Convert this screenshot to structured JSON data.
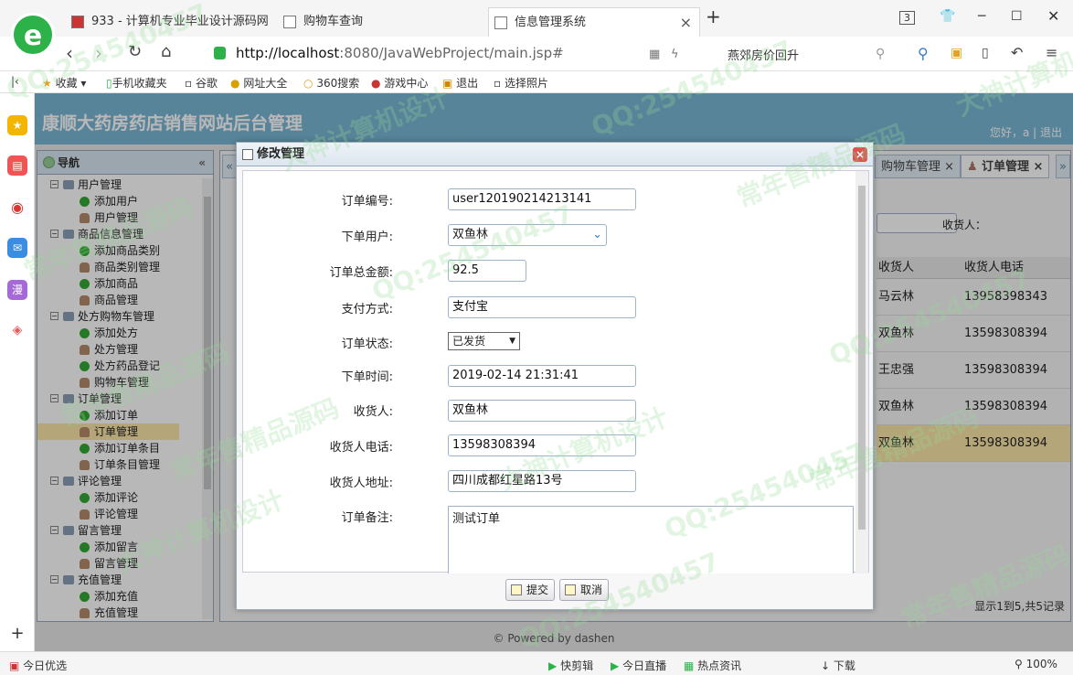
{
  "browser": {
    "logo_letter": "e",
    "tabs": [
      {
        "title": "933 - 计算机专业毕业设计源码网"
      },
      {
        "title": "购物车查询"
      },
      {
        "title": "信息管理系统",
        "close": "×"
      }
    ],
    "new_tab": "+",
    "tab_count": "3",
    "url_host": "http://localhost",
    "url_rest": ":8080/JavaWebProject/main.jsp#",
    "news": "燕郊房价回升",
    "bookmarks": [
      "收藏",
      "手机收藏夹",
      "谷歌",
      "网址大全",
      "360搜索",
      "游戏中心",
      "退出",
      "选择照片"
    ],
    "status_left": "今日优选",
    "status_items": [
      "快剪辑",
      "今日直播",
      "热点资讯",
      "下载"
    ],
    "zoom": "100%"
  },
  "header": {
    "title": "康顺大药房药店销售网站后台管理",
    "user_links": "您好，a | 退出"
  },
  "nav": {
    "title": "导航",
    "collapse": "«",
    "groups": [
      {
        "label": "用户管理",
        "items": [
          {
            "label": "添加用户",
            "kind": "add"
          },
          {
            "label": "用户管理",
            "kind": "user"
          }
        ]
      },
      {
        "label": "商品信息管理",
        "items": [
          {
            "label": "添加商品类别",
            "kind": "add"
          },
          {
            "label": "商品类别管理",
            "kind": "user"
          },
          {
            "label": "添加商品",
            "kind": "add"
          },
          {
            "label": "商品管理",
            "kind": "user"
          }
        ]
      },
      {
        "label": "处方购物车管理",
        "items": [
          {
            "label": "添加处方",
            "kind": "add"
          },
          {
            "label": "处方管理",
            "kind": "user"
          },
          {
            "label": "处方药品登记",
            "kind": "add"
          },
          {
            "label": "购物车管理",
            "kind": "user"
          }
        ]
      },
      {
        "label": "订单管理",
        "items": [
          {
            "label": "添加订单",
            "kind": "add"
          },
          {
            "label": "订单管理",
            "kind": "user",
            "selected": true
          },
          {
            "label": "添加订单条目",
            "kind": "add"
          },
          {
            "label": "订单条目管理",
            "kind": "user"
          }
        ]
      },
      {
        "label": "评论管理",
        "items": [
          {
            "label": "添加评论",
            "kind": "add"
          },
          {
            "label": "评论管理",
            "kind": "user"
          }
        ]
      },
      {
        "label": "留言管理",
        "items": [
          {
            "label": "添加留言",
            "kind": "add"
          },
          {
            "label": "留言管理",
            "kind": "user"
          }
        ]
      },
      {
        "label": "充值管理",
        "items": [
          {
            "label": "添加充值",
            "kind": "add"
          },
          {
            "label": "充值管理",
            "kind": "user"
          }
        ]
      }
    ]
  },
  "main": {
    "tabs": [
      {
        "label": "购物车管理 ×"
      },
      {
        "label": "订单管理 ×"
      }
    ],
    "filter_label": "收货人：",
    "columns": [
      "收货人",
      "收货人电话"
    ],
    "rows": [
      {
        "name": "马云林",
        "phone": "13958398343"
      },
      {
        "name": "双鱼林",
        "phone": "13598308394"
      },
      {
        "name": "王忠强",
        "phone": "13598308394"
      },
      {
        "name": "双鱼林",
        "phone": "13598308394"
      },
      {
        "name": "双鱼林",
        "phone": "13598308394",
        "selected": true
      }
    ],
    "pager": "显示1到5,共5记录"
  },
  "footer": "© Powered by dashen",
  "dialog": {
    "title": "修改管理",
    "close": "×",
    "fields": {
      "order_no": {
        "label": "订单编号:",
        "value": "user120190214213141"
      },
      "user": {
        "label": "下单用户:",
        "value": "双鱼林"
      },
      "total": {
        "label": "订单总金额:",
        "value": "92.5"
      },
      "pay": {
        "label": "支付方式:",
        "value": "支付宝"
      },
      "state": {
        "label": "订单状态:",
        "value": "已发货"
      },
      "time": {
        "label": "下单时间:",
        "value": "2019-02-14 21:31:41"
      },
      "receiver": {
        "label": "收货人:",
        "value": "双鱼林"
      },
      "phone": {
        "label": "收货人电话:",
        "value": "13598308394"
      },
      "address": {
        "label": "收货人地址:",
        "value": "四川成都红星路13号"
      },
      "memo": {
        "label": "订单备注:",
        "value": "测试订单"
      }
    },
    "submit": "提交",
    "cancel": "取消"
  },
  "watermarks": [
    "QQ:254540457",
    "常年售精品源码",
    "大神计算机设计"
  ]
}
